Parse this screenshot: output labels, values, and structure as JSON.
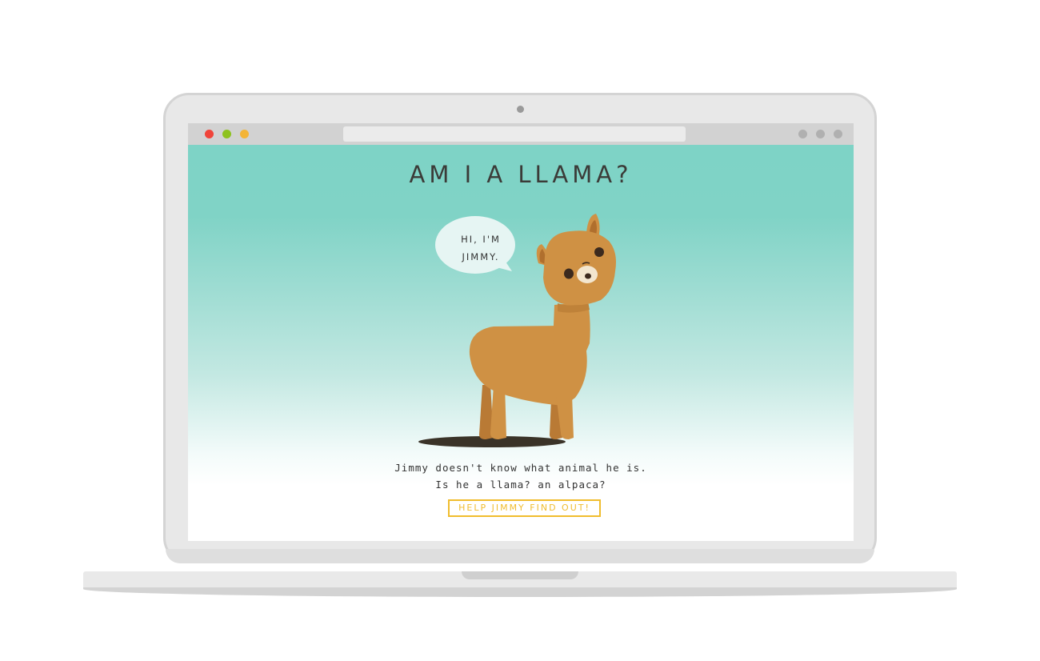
{
  "window": {
    "traffic_lights": [
      {
        "name": "close",
        "color": "#f0443a"
      },
      {
        "name": "minimize",
        "color": "#8ec21f"
      },
      {
        "name": "zoom",
        "color": "#f3b436"
      }
    ],
    "right_dots_color": "#b0b0b0",
    "url_value": ""
  },
  "page": {
    "title": "AM I A LLAMA?",
    "speech_bubble": {
      "line1": "HI, I'M",
      "line2": "JIMMY."
    },
    "description": {
      "line1": "Jimmy doesn't know what animal he is.",
      "line2": "Is he a llama? an alpaca?"
    },
    "cta_label": "HELP JIMMY FIND OUT!",
    "colors": {
      "background_top": "#7ed3c6",
      "accent": "#f0bd2e",
      "text": "#3b3b38",
      "alpaca_fur": "#cf9144"
    }
  }
}
